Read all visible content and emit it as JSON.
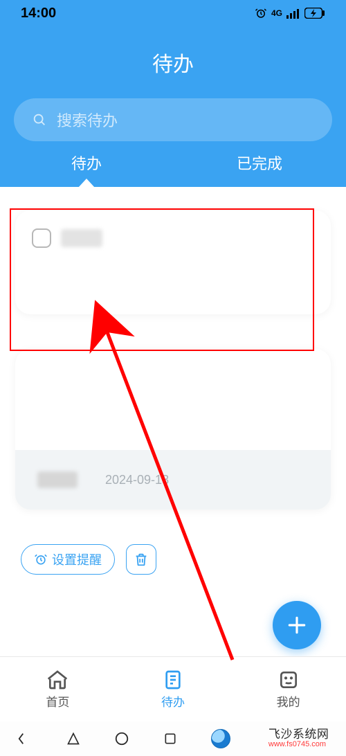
{
  "status_bar": {
    "time": "14:00",
    "network": "4G"
  },
  "header": {
    "title": "待办",
    "search_placeholder": "搜索待办",
    "tabs": [
      {
        "label": "待办",
        "active": true
      },
      {
        "label": "已完成",
        "active": false
      }
    ]
  },
  "todo_card": {
    "item_text": ""
  },
  "date_card": {
    "label": "",
    "date": "2024-09-13"
  },
  "actions": {
    "set_reminder": "设置提醒"
  },
  "bottom_nav": {
    "items": [
      {
        "label": "首页",
        "active": false
      },
      {
        "label": "待办",
        "active": true
      },
      {
        "label": "我的",
        "active": false
      }
    ]
  },
  "watermark": {
    "brand": "飞沙系统网",
    "url": "www.fs0745.com"
  },
  "colors": {
    "primary": "#3aa3f2",
    "annotation": "#ff0000"
  }
}
